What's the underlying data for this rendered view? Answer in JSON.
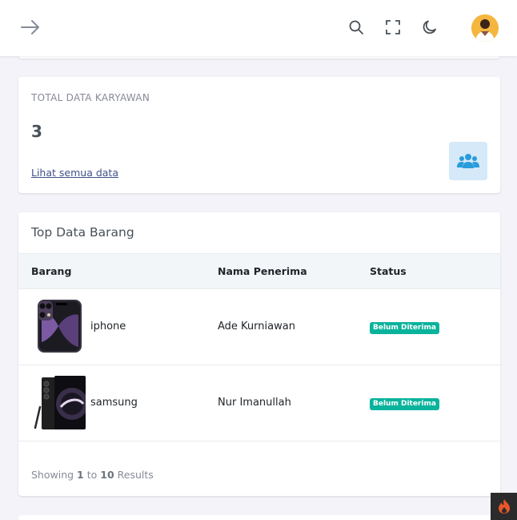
{
  "topbar": {
    "menu_toggle_icon": "arrow-right-icon",
    "icons": [
      "search-icon",
      "fullscreen-icon",
      "moon-icon"
    ],
    "avatar_icon": "user-avatar"
  },
  "stat_card": {
    "label": "TOTAL DATA KARYAWAN",
    "value": "3",
    "link": "Lihat semua data",
    "icon": "users-icon",
    "icon_color": "#299cdb",
    "icon_bg": "#d5e9f8"
  },
  "table": {
    "title": "Top Data Barang",
    "columns": [
      "Barang",
      "Nama Penerima",
      "Status"
    ],
    "rows": [
      {
        "image": "iphone-image",
        "name": "iphone",
        "receiver": "Ade Kurniawan",
        "status": "Belum Diterima"
      },
      {
        "image": "samsung-image",
        "name": "samsung",
        "receiver": "Nur Imanullah",
        "status": "Belum Diterima"
      }
    ],
    "footer": {
      "prefix": "Showing",
      "from": "1",
      "to_word": "to",
      "to": "10",
      "suffix": "Results"
    },
    "status_color": "#0ab39c"
  },
  "codeigniter_badge_icon": "flame-icon"
}
